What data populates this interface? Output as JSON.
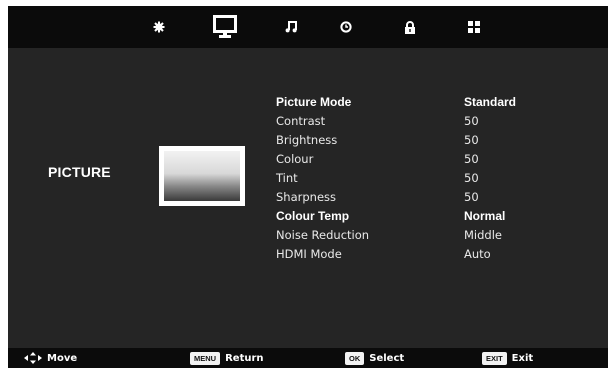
{
  "tabs": [
    {
      "icon": "gear-icon"
    },
    {
      "icon": "monitor-icon",
      "active": true
    },
    {
      "icon": "music-note-icon"
    },
    {
      "icon": "clock-icon"
    },
    {
      "icon": "lock-icon"
    },
    {
      "icon": "grid-icon"
    }
  ],
  "section": {
    "title": "PICTURE"
  },
  "menu": {
    "picture_mode": {
      "label": "Picture Mode",
      "value": "Standard"
    },
    "contrast": {
      "label": "Contrast",
      "value": "50"
    },
    "brightness": {
      "label": "Brightness",
      "value": "50"
    },
    "colour": {
      "label": "Colour",
      "value": "50"
    },
    "tint": {
      "label": "Tint",
      "value": "50"
    },
    "sharpness": {
      "label": "Sharpness",
      "value": "50"
    },
    "colour_temp": {
      "label": "Colour Temp",
      "value": "Normal"
    },
    "noise_reduction": {
      "label": "Noise Reduction",
      "value": "Middle"
    },
    "hdmi_mode": {
      "label": "HDMI Mode",
      "value": "Auto"
    }
  },
  "footer": {
    "move": {
      "icon": "dpad-arrows-icon",
      "label": "Move"
    },
    "return": {
      "key": "MENU",
      "label": "Return"
    },
    "select": {
      "key": "OK",
      "label": "Select"
    },
    "exit": {
      "key": "EXIT",
      "label": "Exit"
    }
  },
  "colors": {
    "background": "#252525",
    "bar": "#0b0b0b",
    "text": "#ffffff"
  }
}
